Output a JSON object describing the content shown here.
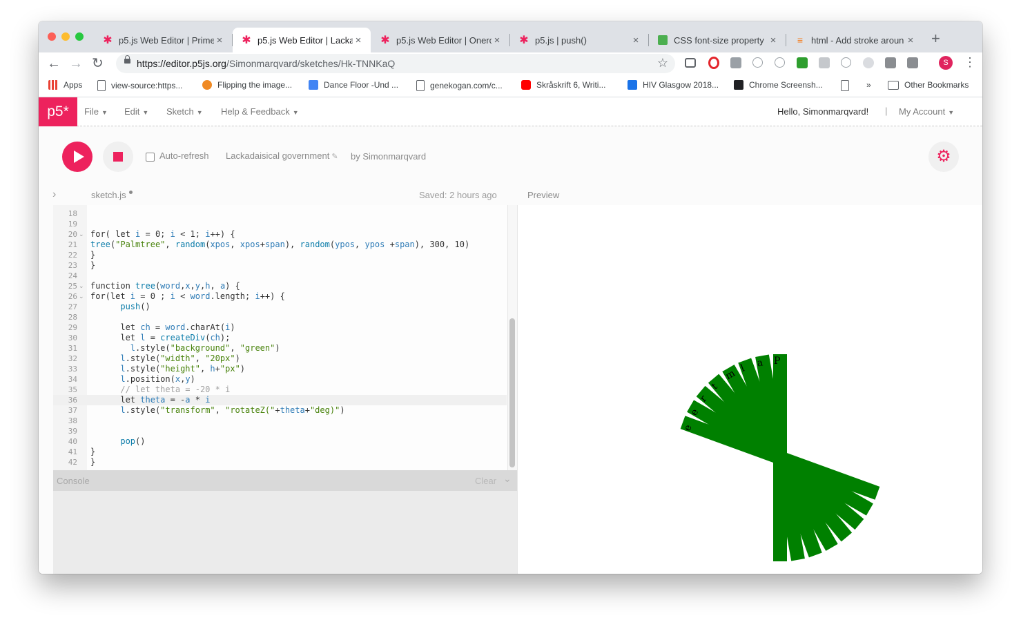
{
  "browser": {
    "tabs": [
      {
        "title": "p5.js Web Editor | Prime",
        "icon": "p5-asterisk-icon"
      },
      {
        "title": "p5.js Web Editor | Lacka",
        "icon": "p5-asterisk-icon",
        "active": true
      },
      {
        "title": "p5.js Web Editor | Onerc",
        "icon": "p5-asterisk-icon"
      },
      {
        "title": "p5.js | push()",
        "icon": "p5-asterisk-icon"
      },
      {
        "title": "CSS font-size property",
        "icon": "w3schools-icon"
      },
      {
        "title": "html - Add stroke aroun",
        "icon": "stackoverflow-icon"
      }
    ],
    "new_tab": "+",
    "url_host": "https://editor.p5js.org",
    "url_path": "/Simonmarqvard/sketches/Hk-TNNKaQ",
    "profile_initial": "S",
    "bookmarks": [
      {
        "label": "Apps",
        "icon": "apps-grid-icon"
      },
      {
        "label": "view-source:https...",
        "icon": "page-icon"
      },
      {
        "label": "Flipping the image...",
        "icon": "site-icon"
      },
      {
        "label": "Dance Floor -Und ...",
        "icon": "docs-icon"
      },
      {
        "label": "genekogan.com/c...",
        "icon": "page-icon"
      },
      {
        "label": "Skråskrift 6, Writi...",
        "icon": "youtube-icon"
      },
      {
        "label": "HIV Glasgow 2018...",
        "icon": "h-icon"
      },
      {
        "label": "Chrome Screensh...",
        "icon": "extension-icon"
      }
    ],
    "bookmarks_more": "»",
    "other_bookmarks": "Other Bookmarks"
  },
  "app": {
    "logo": "p5*",
    "menu": [
      "File",
      "Edit",
      "Sketch",
      "Help & Feedback"
    ],
    "hello": "Hello, Simonmarqvard!",
    "divider": "|",
    "account": "My Account",
    "auto_refresh": "Auto-refresh",
    "sketch_name": "Lackadaisical government",
    "by_user": "by Simonmarqvard",
    "file_name": "sketch.js",
    "saved": "Saved: 2 hours ago",
    "preview_label": "Preview",
    "console_label": "Console",
    "clear_label": "Clear",
    "accent_color": "#ed225d"
  },
  "code": [
    {
      "n": "18",
      "t": ""
    },
    {
      "n": "19",
      "t": ""
    },
    {
      "n": "20",
      "t": "for( let i = 0; i < 1; i++) {",
      "fold": true
    },
    {
      "n": "21",
      "t": "tree(\"Palmtree\", random(xpos, xpos+span), random(ypos, ypos +span), 300, 10)"
    },
    {
      "n": "22",
      "t": "}"
    },
    {
      "n": "23",
      "t": "}"
    },
    {
      "n": "24",
      "t": ""
    },
    {
      "n": "25",
      "t": "function tree(word,x,y,h, a) {",
      "fold": true
    },
    {
      "n": "26",
      "t": "for(let i = 0 ; i < word.length; i++) {",
      "fold": true
    },
    {
      "n": "27",
      "t": "      push()"
    },
    {
      "n": "28",
      "t": ""
    },
    {
      "n": "29",
      "t": "      let ch = word.charAt(i)"
    },
    {
      "n": "30",
      "t": "      let l = createDiv(ch);"
    },
    {
      "n": "31",
      "t": "        l.style(\"background\", \"green\")"
    },
    {
      "n": "32",
      "t": "      l.style(\"width\", \"20px\")"
    },
    {
      "n": "33",
      "t": "      l.style(\"height\", h+\"px\")"
    },
    {
      "n": "34",
      "t": "      l.position(x,y)"
    },
    {
      "n": "35",
      "t": "      // let theta = -20 * i"
    },
    {
      "n": "36",
      "t": "      let theta = -a * i",
      "current": true
    },
    {
      "n": "37",
      "t": "      l.style(\"transform\", \"rotateZ(\"+theta+\"deg)\")"
    },
    {
      "n": "38",
      "t": ""
    },
    {
      "n": "39",
      "t": ""
    },
    {
      "n": "40",
      "t": "      pop()"
    },
    {
      "n": "41",
      "t": "}"
    },
    {
      "n": "42",
      "t": "}"
    }
  ],
  "preview": {
    "word": "Palmtree",
    "leaf_color": "#008000",
    "leaf_count": 8,
    "angle_step_deg": 10
  }
}
